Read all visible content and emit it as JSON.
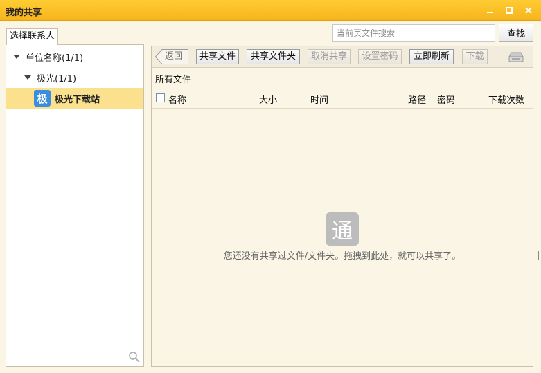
{
  "window": {
    "title": "我的共享",
    "controls": {
      "minimize": "minimize-icon",
      "maximize": "maximize-icon",
      "close": "close-icon"
    }
  },
  "search": {
    "placeholder": "当前页文件搜索",
    "value": "",
    "button_label": "查找"
  },
  "left": {
    "tab_label": "选择联系人",
    "tree": [
      {
        "label": "单位名称(1/1)",
        "expanded": true,
        "level": 0
      },
      {
        "label": "极光(1/1)",
        "expanded": true,
        "level": 1
      },
      {
        "label": "极光下载站",
        "icon_text": "极",
        "selected": true,
        "level": 2
      }
    ],
    "search_placeholder": "",
    "search_icon": "search-icon"
  },
  "toolbar": {
    "back_label": "返回",
    "buttons": [
      {
        "label": "共享文件",
        "enabled": true
      },
      {
        "label": "共享文件夹",
        "enabled": true
      },
      {
        "label": "取消共享",
        "enabled": false
      },
      {
        "label": "设置密码",
        "enabled": false
      },
      {
        "label": "立即刷新",
        "enabled": true
      },
      {
        "label": "下载",
        "enabled": false
      }
    ],
    "printer_icon": "printer-icon"
  },
  "main": {
    "breadcrumb": "所有文件",
    "columns": [
      "名称",
      "大小",
      "时间",
      "路径",
      "密码",
      "下载次数"
    ],
    "rows": [],
    "empty_logo_text": "通",
    "empty_message": "您还没有共享过文件/文件夹。拖拽到此处，就可以共享了。"
  },
  "colors": {
    "titlebar": "#f6b41c",
    "panel_bg": "#fbf5e6",
    "selected_row": "#fbe08d",
    "contact_icon": "#3a8ee0"
  }
}
